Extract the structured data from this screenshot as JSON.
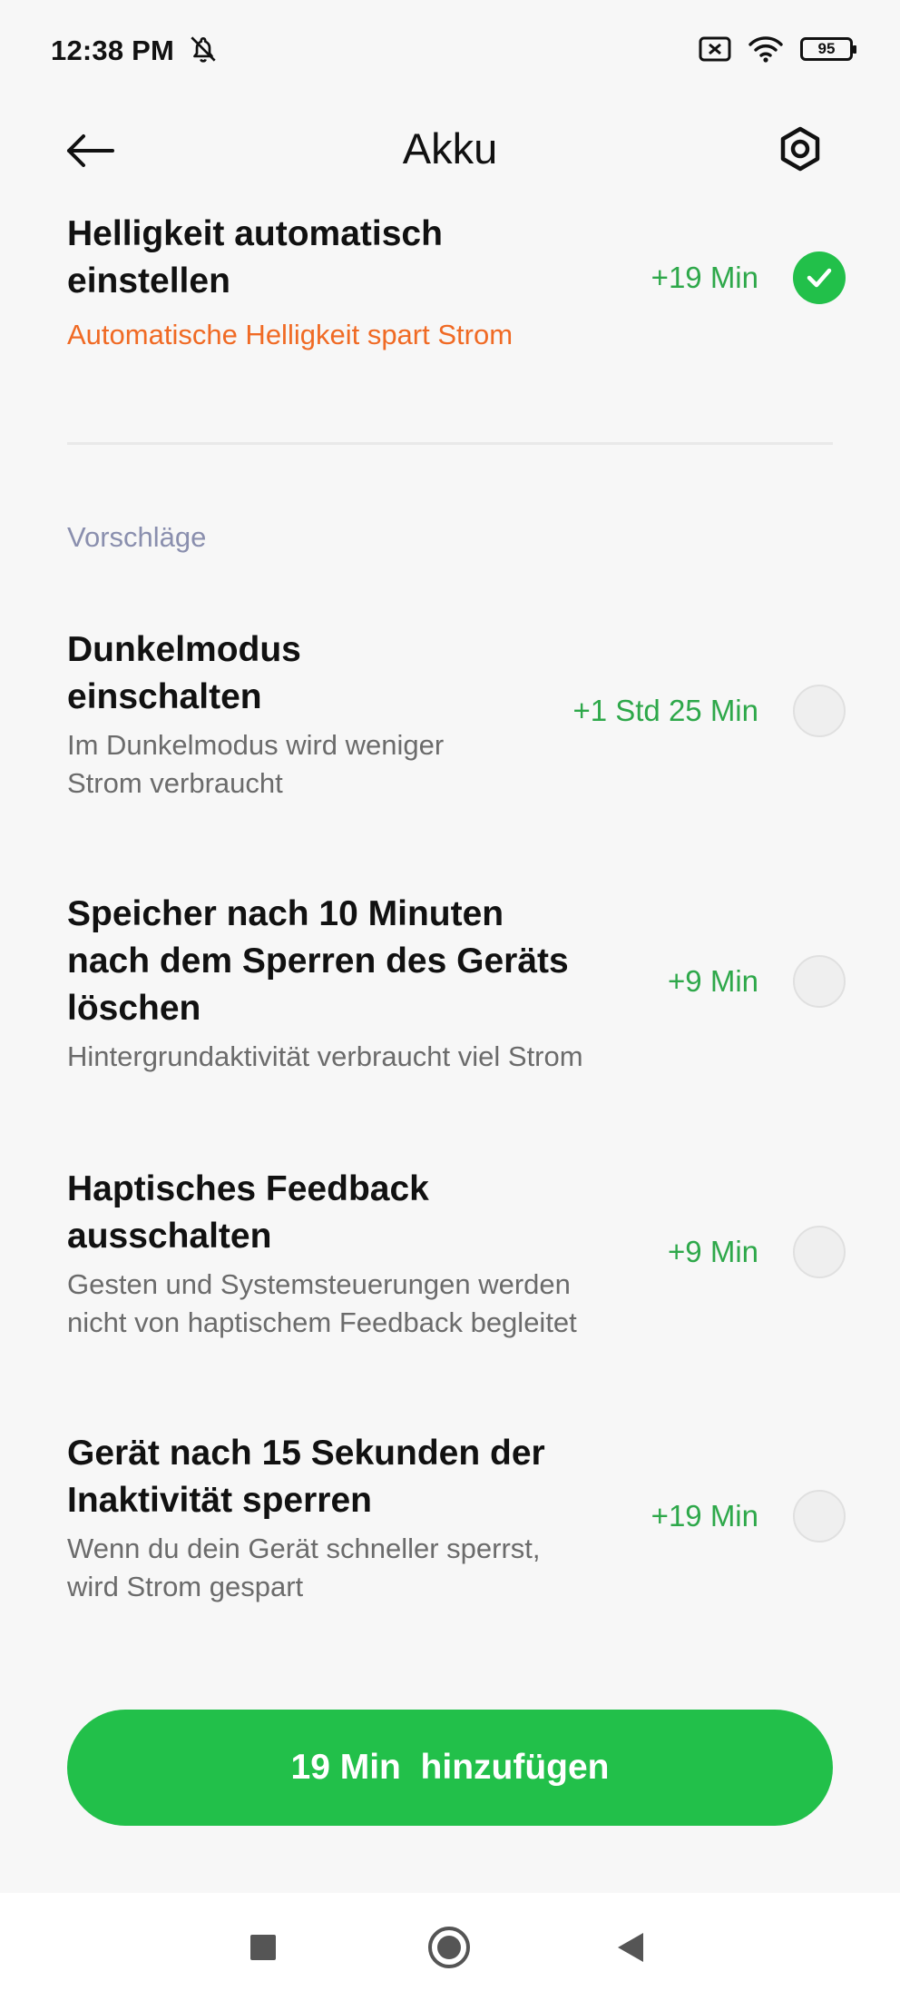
{
  "status_bar": {
    "time": "12:38 PM",
    "battery_level": "95",
    "icons": [
      "alarm-off-icon",
      "sim-off-icon",
      "wifi-icon",
      "battery-icon"
    ]
  },
  "app_bar": {
    "title": "Akku",
    "back_icon": "arrow-left-icon",
    "settings_icon": "gear-icon"
  },
  "current_item": {
    "title_line1": "Helligkeit automatisch",
    "title_line2": "einstellen",
    "description": "Automatische Helligkeit spart Strom",
    "gain": "+19 Min",
    "checked": true
  },
  "suggestions": {
    "label": "Vorschläge",
    "items": [
      {
        "title_line1": "Dunkelmodus",
        "title_line2": "einschalten",
        "desc_line1": "Im Dunkelmodus wird weniger",
        "desc_line2": "Strom verbraucht",
        "gain": "+1 Std 25 Min",
        "checked": false
      },
      {
        "title_line1": "Speicher nach 10 Minuten",
        "title_line2": "nach dem Sperren des Geräts",
        "title_line3": "löschen",
        "desc_line1": "Hintergrundaktivität verbraucht viel Strom",
        "gain": "+9 Min",
        "checked": false
      },
      {
        "title_line1": "Haptisches Feedback",
        "title_line2": "ausschalten",
        "desc_line1": "Gesten und Systemsteuerungen werden",
        "desc_line2": "nicht von haptischem Feedback begleitet",
        "gain": "+9 Min",
        "checked": false
      },
      {
        "title_line1": "Gerät nach 15 Sekunden der",
        "title_line2": "Inaktivität sperren",
        "desc_line1": "Wenn du dein Gerät schneller sperrst,",
        "desc_line2": "wird Strom gespart",
        "gain": "+19 Min",
        "checked": false
      }
    ]
  },
  "cta": {
    "label": "19 Min  hinzufügen"
  },
  "nav_bar": {
    "icons": [
      "recents-square-icon",
      "home-circle-icon",
      "back-triangle-icon"
    ]
  },
  "colors": {
    "accent_green": "#22c04a",
    "gain_green": "#2ea84a",
    "warning_orange": "#f06a24",
    "section_label": "#8a8fae"
  }
}
